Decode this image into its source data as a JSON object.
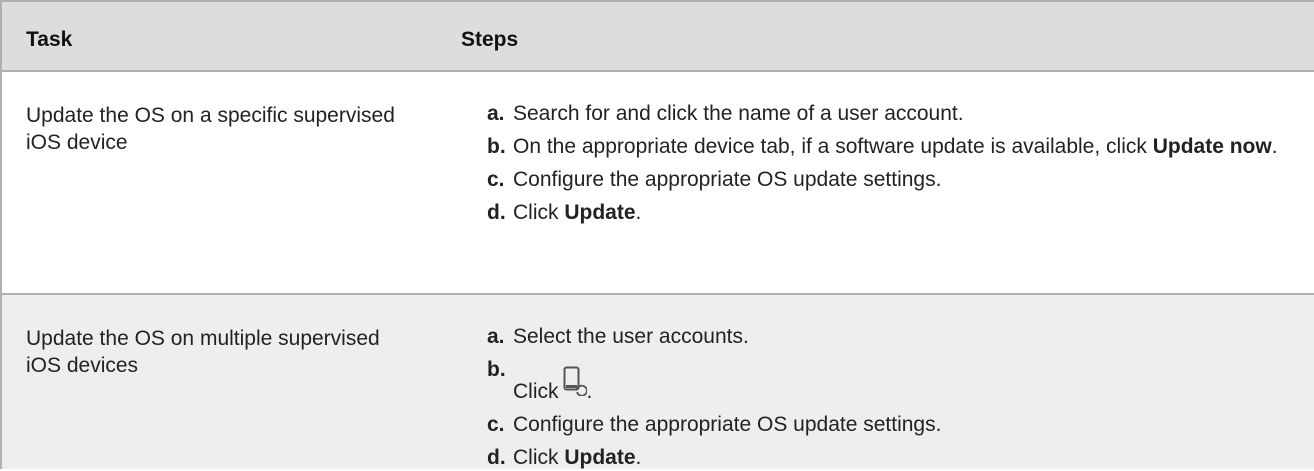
{
  "table": {
    "headers": {
      "task": "Task",
      "steps": "Steps"
    },
    "rows": [
      {
        "task": "Update the OS on a specific supervised iOS device",
        "steps": [
          {
            "letter": "a.",
            "text": "Search for and click the name of a user account."
          },
          {
            "letter": "b.",
            "text_before": "On the appropriate device tab, if a software update is available, click ",
            "bold": "Update now",
            "text_after": "."
          },
          {
            "letter": "c.",
            "text": "Configure the appropriate OS update settings."
          },
          {
            "letter": "d.",
            "text_before": "Click ",
            "bold": "Update",
            "text_after": "."
          }
        ]
      },
      {
        "task": "Update the OS on multiple supervised iOS devices",
        "steps": [
          {
            "letter": "a.",
            "text": "Select the user accounts."
          },
          {
            "letter": "b.",
            "text_before": "Click ",
            "icon": "device-update-icon",
            "text_after": "."
          },
          {
            "letter": "c.",
            "text": "Configure the appropriate OS update settings."
          },
          {
            "letter": "d.",
            "text_before": "Click ",
            "bold": "Update",
            "text_after": "."
          }
        ]
      }
    ]
  },
  "colors": {
    "header_bg": "#dddddd",
    "row_alt_bg": "#eeeeee",
    "border": "#b0b0b0",
    "text": "#222222"
  }
}
